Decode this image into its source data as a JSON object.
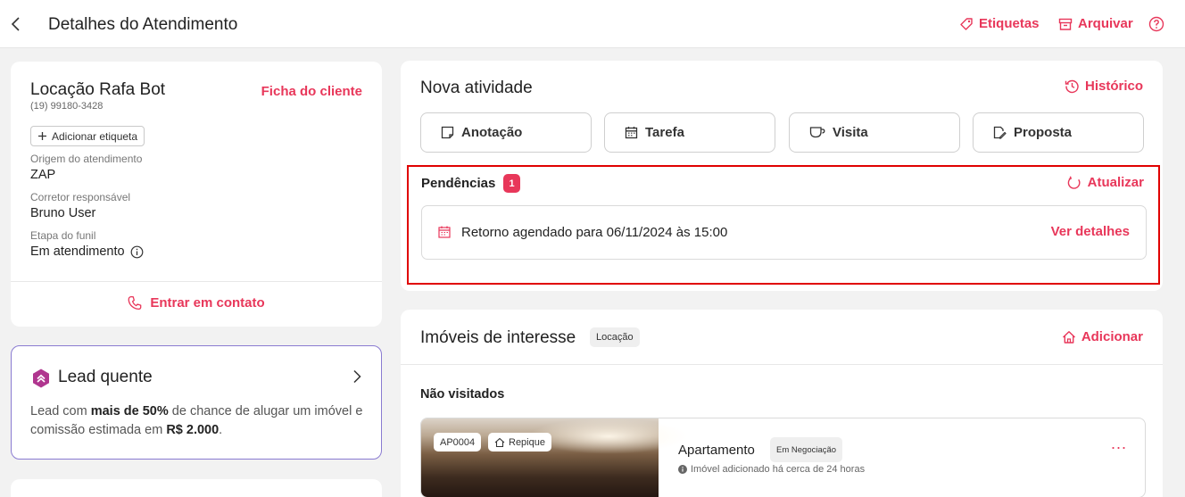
{
  "header": {
    "title": "Detalhes do Atendimento",
    "tags_label": "Etiquetas",
    "archive_label": "Arquivar"
  },
  "client": {
    "name": "Locação Rafa Bot",
    "phone": "(19) 99180-3428",
    "sheet_link": "Ficha do cliente",
    "add_tag": "Adicionar etiqueta",
    "fields": [
      {
        "label": "Origem do atendimento",
        "value": "ZAP"
      },
      {
        "label": "Corretor responsável",
        "value": "Bruno User"
      },
      {
        "label": "Etapa do funil",
        "value": "Em atendimento"
      }
    ],
    "contact_label": "Entrar em contato"
  },
  "lead": {
    "title": "Lead quente",
    "desc_prefix": "Lead com ",
    "desc_bold1": "mais de 50%",
    "desc_mid": " de chance de alugar um imóvel e comissão estimada em ",
    "desc_bold2": "R$ 2.000",
    "desc_suffix": "."
  },
  "activity": {
    "title": "Nova atividade",
    "history_label": "Histórico",
    "buttons": [
      "Anotação",
      "Tarefa",
      "Visita",
      "Proposta"
    ]
  },
  "pending": {
    "title": "Pendências",
    "count": "1",
    "refresh_label": "Atualizar",
    "item_text": "Retorno agendado para 06/11/2024 às 15:00",
    "item_link": "Ver detalhes"
  },
  "properties": {
    "title": "Imóveis de interesse",
    "chip": "Locação",
    "add_label": "Adicionar",
    "subtitle": "Não visitados",
    "item": {
      "code": "AP0004",
      "tag": "Repique",
      "type": "Apartamento",
      "status": "Em Negociação",
      "note": "Imóvel adicionado há cerca de 24 horas",
      "more": "..."
    }
  },
  "colors": {
    "accent": "#e8375a",
    "lead_border": "#8a7bd1",
    "lead_icon": "#b0368f",
    "highlight_border": "#e00000"
  }
}
